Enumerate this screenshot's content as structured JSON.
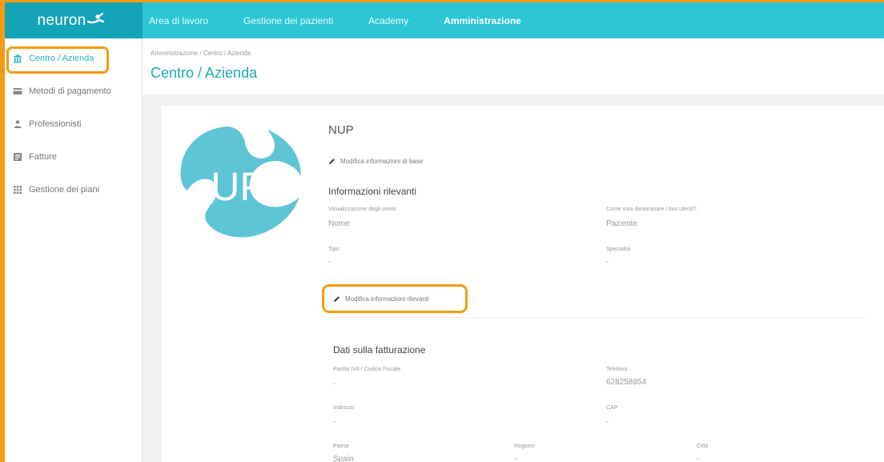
{
  "app": {
    "logo_text": "neuron"
  },
  "nav": {
    "items": [
      {
        "label": "Area di lavoro",
        "active": false
      },
      {
        "label": "Gestione dei pazienti",
        "active": false
      },
      {
        "label": "Academy",
        "active": false
      },
      {
        "label": "Amministrazione",
        "active": true
      }
    ]
  },
  "sidebar": {
    "items": [
      {
        "label": "Centro / Azienda",
        "icon": "building-icon",
        "active": true
      },
      {
        "label": "Metodi di pagamento",
        "icon": "credit-card-icon",
        "active": false
      },
      {
        "label": "Professionisti",
        "icon": "user-icon",
        "active": false
      },
      {
        "label": "Fatture",
        "icon": "invoice-icon",
        "active": false
      },
      {
        "label": "Gestione dei piani",
        "icon": "grid-icon",
        "active": false
      }
    ]
  },
  "header": {
    "breadcrumb": "Amministrazione / Centro / Azienda",
    "title": "Centro / Azienda"
  },
  "org": {
    "name": "NUP",
    "logo_text": "UP",
    "edit_basic_label": "Modifica informazioni di base"
  },
  "relevant": {
    "title": "Informazioni rilevanti",
    "user_display_label": "Visualizzazione degli utenti",
    "user_display_value": "Nome",
    "denominate_label": "Come vuoi denominare i tuoi utenti?:",
    "denominate_value": "Paziente",
    "type_label": "Tipo",
    "type_value": "-",
    "specialty_label": "Specialità",
    "specialty_value": "-",
    "edit_label": "Modifica informazioni rilevanti"
  },
  "billing": {
    "title": "Dati sulla fatturazione",
    "vat_label": "Partita IVA / Codice Fiscale",
    "vat_value": "-",
    "phone_label": "Telefono",
    "phone_value": "628258954",
    "address_label": "Indirizzo",
    "address_value": "-",
    "zip_label": "CAP",
    "zip_value": "-",
    "country_label": "Paese",
    "country_value": "Spain",
    "region_label": "Regione",
    "region_value": "-",
    "city_label": "Città",
    "city_value": "-"
  },
  "colors": {
    "accent": "#2cc6d4",
    "logo_bg": "#15a4b7",
    "highlight": "#f39c12",
    "title": "#1ba9b9"
  }
}
